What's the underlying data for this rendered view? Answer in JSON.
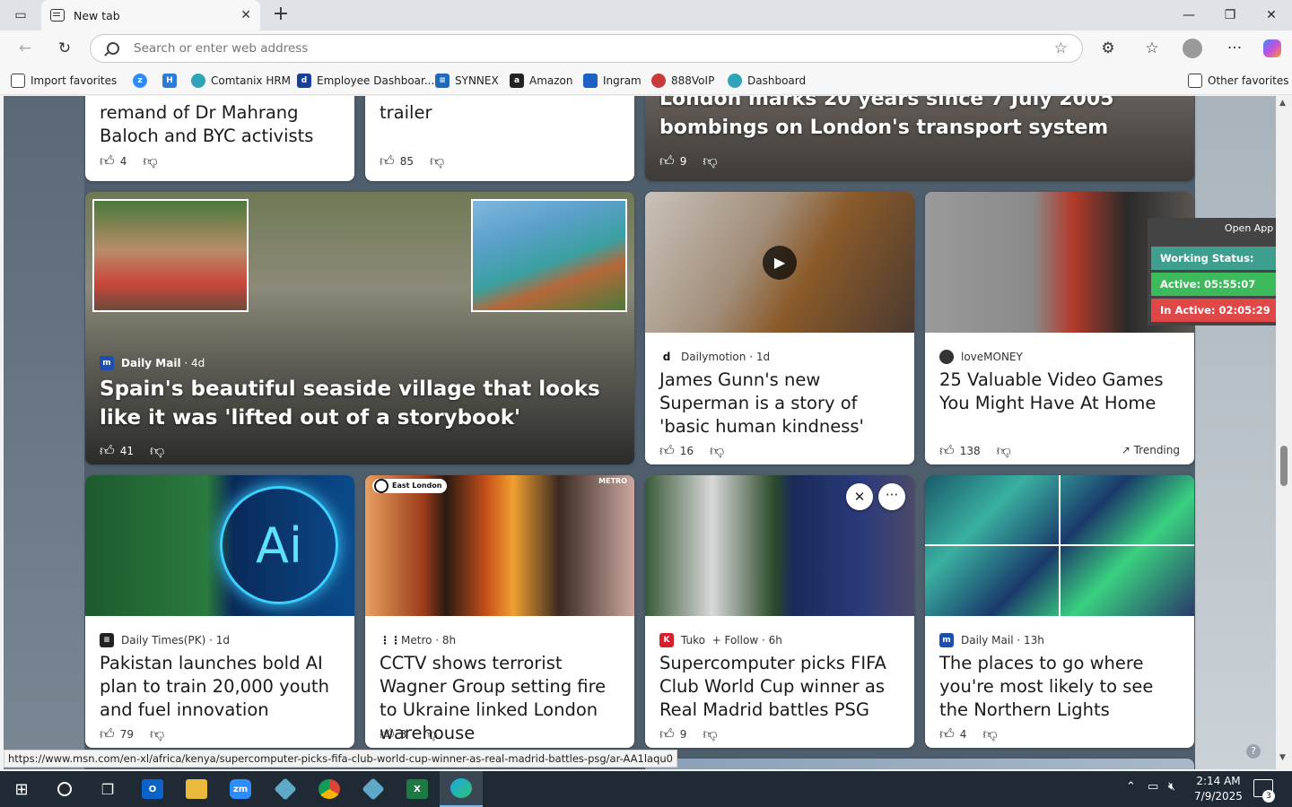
{
  "browser": {
    "tab_title": "New tab",
    "address_placeholder": "Search or enter web address"
  },
  "favorites": [
    {
      "label": "Import favorites",
      "icon": "import-icon"
    },
    {
      "label": "",
      "icon": "zoom-icon"
    },
    {
      "label": "",
      "icon": "hr-icon"
    },
    {
      "label": "Comtanix HRM",
      "icon": "comtanix-icon"
    },
    {
      "label": "Employee Dashboar...",
      "icon": "dashboard-icon"
    },
    {
      "label": "SYNNEX",
      "icon": "synnex-icon"
    },
    {
      "label": "Amazon",
      "icon": "amazon-icon"
    },
    {
      "label": "Ingram",
      "icon": "ingram-icon"
    },
    {
      "label": "888VoIP",
      "icon": "voip-icon"
    },
    {
      "label": "Dashboard",
      "icon": "dashboard2-icon"
    },
    {
      "label": "Other favorites",
      "icon": "folder-icon"
    }
  ],
  "cards": {
    "c1": {
      "title": "remand of Dr Mahrang Baloch and BYC activists",
      "likes": "4"
    },
    "c2": {
      "title": "trailer",
      "likes": "85"
    },
    "c3": {
      "title": "London marks 20 years since 7 July 2005 bombings on London's transport system",
      "likes": "9"
    },
    "c4": {
      "source": "Daily Mail",
      "age": "· 4d",
      "title": "Spain's beautiful seaside village that looks like it was 'lifted out of a storybook'",
      "likes": "41"
    },
    "c5": {
      "source": "Dailymotion",
      "age": "· 1d",
      "title": "James Gunn's new Superman is a story of 'basic human kindness'",
      "likes": "16"
    },
    "c6": {
      "source": "loveMONEY",
      "age": "",
      "title": "25 Valuable Video Games You Might Have At Home",
      "likes": "138",
      "trend": "Trending"
    },
    "c7": {
      "source": "Daily Times(PK)",
      "age": "· 1d",
      "title": "Pakistan launches bold AI plan to train 20,000 youth and fuel innovation",
      "likes": "79",
      "img_text": "Ai"
    },
    "c8": {
      "source": "Metro",
      "age": "· 8h",
      "title": "CCTV shows terrorist Wagner Group setting fire to Ukraine linked London warehouse",
      "likes": "3",
      "badge": "East London",
      "brand": "METRO"
    },
    "c9": {
      "source": "Tuko",
      "follow": "+ Follow",
      "age": "· 6h",
      "title": "Supercomputer picks FIFA Club World Cup winner as Real Madrid battles PSG",
      "likes": "9"
    },
    "c10": {
      "source": "Daily Mail",
      "age": "· 13h",
      "title": "The places to go where you're most likely to see the Northern Lights",
      "likes": "4"
    }
  },
  "work_status": {
    "open_app": "Open App ↗",
    "status": "Working Status: Active",
    "active": "Active: 05:55:07",
    "inactive": "In Active: 02:05:29"
  },
  "status_url": "https://www.msn.com/en-xl/africa/kenya/supercomputer-picks-fifa-club-world-cup-winner-as-real-madrid-battles-psg/ar-AA1laqu0",
  "taskbar": {
    "time": "2:14 AM",
    "date": "7/9/2025",
    "notifications": "3"
  },
  "colors": {
    "status_active_bg": "#3dba5c",
    "status_inactive_bg": "#e04848",
    "status_header_bg": "#3f9f8f"
  }
}
